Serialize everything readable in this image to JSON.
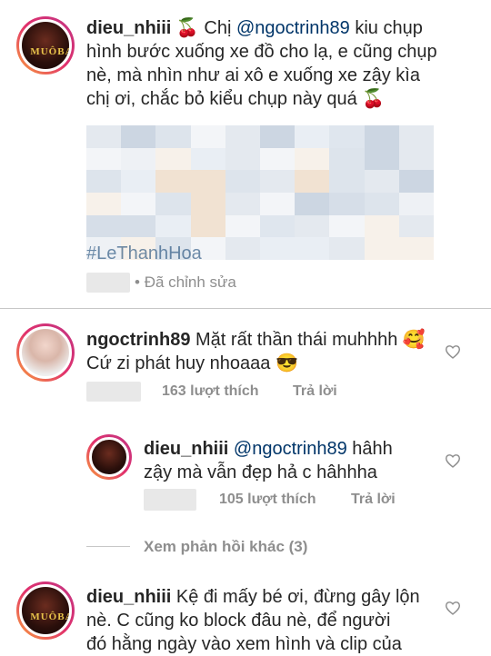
{
  "caption": {
    "username": "dieu_nhiii",
    "emoji_after_user": "🍒",
    "line1_pre": "Chị ",
    "line1_mention": "@ngoctrinh89",
    "line1_post": " kiu chụp",
    "line2": "hình bước xuống xe đồ cho lạ, e cũng chụp",
    "line3": "nè, mà nhìn như ai xô e xuống xe zậy kìa",
    "line4": "chị ơi, chắc bỏ kiểu chụp này quá 🍒",
    "hashtag_partial": "#LeThanhHoa",
    "edited_label": "Đã chỉnh sửa"
  },
  "comments": [
    {
      "username": "ngoctrinh89",
      "line1": "Mặt rất thần thái muhhhh 🥰",
      "line2": "Cứ zi phát huy nhoaaa 😎",
      "likes": "163 lượt thích",
      "reply_label": "Trả lời"
    }
  ],
  "reply": {
    "username": "dieu_nhiii",
    "mention": "@ngoctrinh89",
    "line1_post": " hâhh",
    "line2": "zậy mà vẫn đẹp hả c hâhhha",
    "likes": "105 lượt thích",
    "reply_label": "Trả lời"
  },
  "more_replies": "Xem phản hồi khác (3)",
  "last_comment": {
    "username": "dieu_nhiii",
    "line1": "Kệ đi mấy bé ơi, đừng gây lộn",
    "line2": "nè. C cũng ko block đâu nè, để người",
    "line3": "đó hằng ngày vào xem hình và clip của"
  },
  "icons": {
    "heart": "heart-outline-icon",
    "avatar_logo": "MUÔBA"
  },
  "colors": {
    "mention": "#003569",
    "muted": "#8e8e8e"
  }
}
